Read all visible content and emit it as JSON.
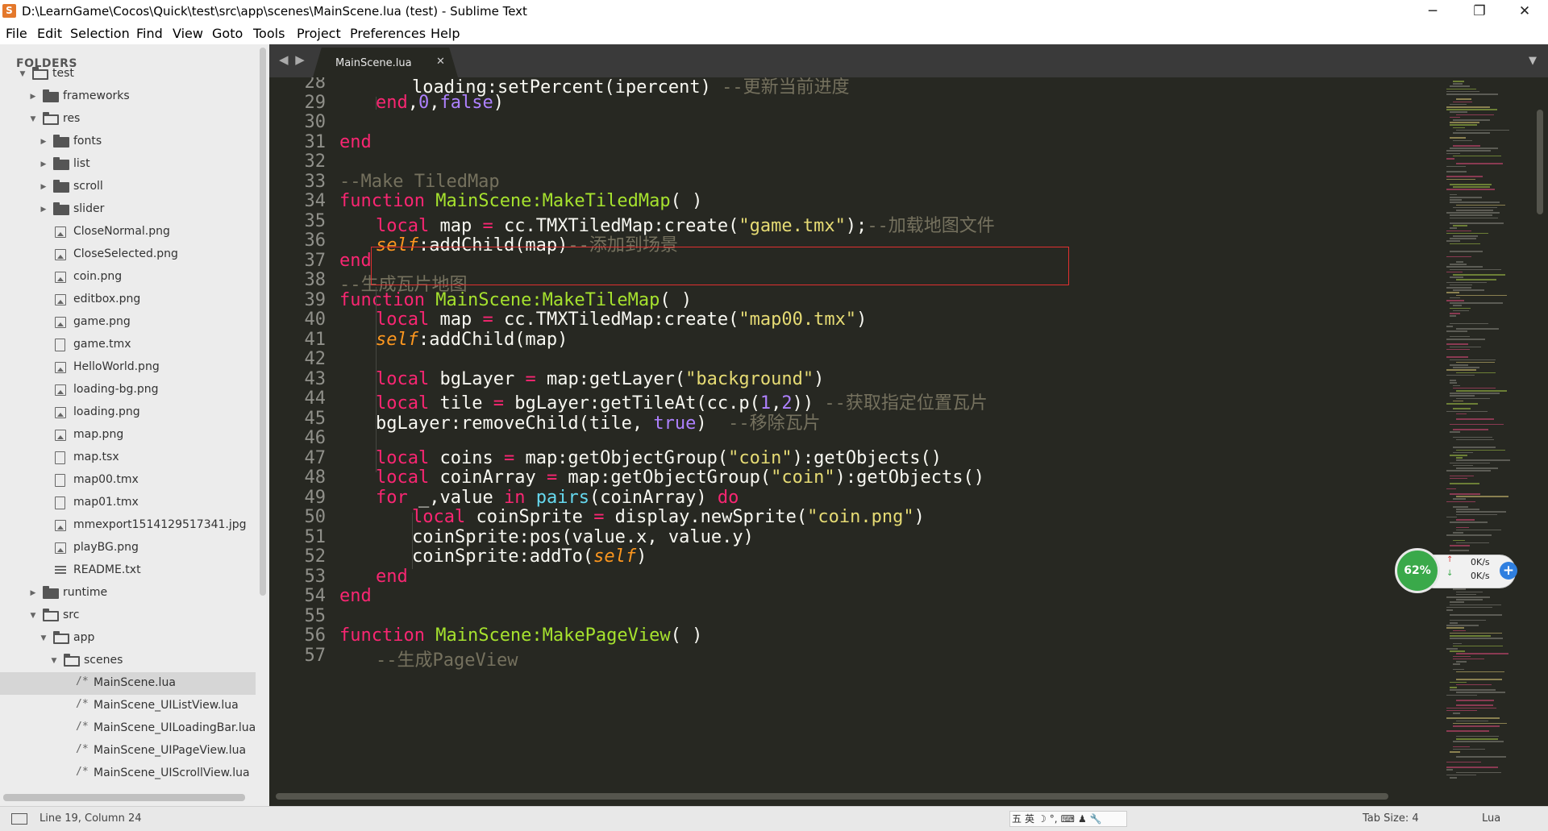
{
  "window": {
    "title": "D:\\LearnGame\\Cocos\\Quick\\test\\src\\app\\scenes\\MainScene.lua (test) - Sublime Text",
    "app_icon_glyph": "S",
    "minimize_glyph": "─",
    "maximize_glyph": "❐",
    "close_glyph": "✕"
  },
  "menu": [
    "File",
    "Edit",
    "Selection",
    "Find",
    "View",
    "Goto",
    "Tools",
    "Project",
    "Preferences",
    "Help"
  ],
  "sidebar": {
    "header": "FOLDERS",
    "tree": [
      {
        "label": "test",
        "type": "folder",
        "expanded": true
      },
      {
        "label": "frameworks",
        "type": "folder",
        "expanded": false
      },
      {
        "label": "res",
        "type": "folder",
        "expanded": true
      },
      {
        "label": "fonts",
        "type": "folder",
        "expanded": false
      },
      {
        "label": "list",
        "type": "folder",
        "expanded": false
      },
      {
        "label": "scroll",
        "type": "folder",
        "expanded": false
      },
      {
        "label": "slider",
        "type": "folder",
        "expanded": false
      },
      {
        "label": "CloseNormal.png",
        "type": "image"
      },
      {
        "label": "CloseSelected.png",
        "type": "image"
      },
      {
        "label": "coin.png",
        "type": "image"
      },
      {
        "label": "editbox.png",
        "type": "image"
      },
      {
        "label": "game.png",
        "type": "image"
      },
      {
        "label": "game.tmx",
        "type": "doc"
      },
      {
        "label": "HelloWorld.png",
        "type": "image"
      },
      {
        "label": "loading-bg.png",
        "type": "image"
      },
      {
        "label": "loading.png",
        "type": "image"
      },
      {
        "label": "map.png",
        "type": "image"
      },
      {
        "label": "map.tsx",
        "type": "doc"
      },
      {
        "label": "map00.tmx",
        "type": "doc"
      },
      {
        "label": "map01.tmx",
        "type": "doc"
      },
      {
        "label": "mmexport1514129517341.jpg",
        "type": "image"
      },
      {
        "label": "playBG.png",
        "type": "image"
      },
      {
        "label": "README.txt",
        "type": "text"
      },
      {
        "label": "runtime",
        "type": "folder",
        "expanded": false
      },
      {
        "label": "src",
        "type": "folder",
        "expanded": true
      },
      {
        "label": "app",
        "type": "folder",
        "expanded": true
      },
      {
        "label": "scenes",
        "type": "folder",
        "expanded": true
      },
      {
        "label": "MainScene.lua",
        "type": "lua",
        "selected": true
      },
      {
        "label": "MainScene_UIListView.lua",
        "type": "lua"
      },
      {
        "label": "MainScene_UILoadingBar.lua",
        "type": "lua"
      },
      {
        "label": "MainScene_UIPageView.lua",
        "type": "lua"
      },
      {
        "label": "MainScene_UIScrollView.lua",
        "type": "lua"
      }
    ]
  },
  "tabs": {
    "nav": "◀ ▶",
    "active": {
      "label": "MainScene.lua",
      "close_glyph": "✕"
    },
    "dropdown_glyph": "▼"
  },
  "editor": {
    "lines": [
      {
        "no": "28",
        "indent": 2,
        "tokens": [
          [
            "",
            "loading:setPercent(ipercent) "
          ],
          [
            "cm",
            "--更新当前进度"
          ]
        ]
      },
      {
        "no": "29",
        "indent": 1,
        "tokens": [
          [
            "kw",
            "end"
          ],
          [
            "",
            ","
          ],
          [
            "num",
            "0"
          ],
          [
            "",
            ","
          ],
          [
            "num",
            "false"
          ],
          [
            "",
            ")"
          ]
        ]
      },
      {
        "no": "30",
        "indent": 0,
        "tokens": []
      },
      {
        "no": "31",
        "indent": 0,
        "tokens": [
          [
            "kw",
            "end"
          ]
        ]
      },
      {
        "no": "32",
        "indent": 0,
        "tokens": []
      },
      {
        "no": "33",
        "indent": 0,
        "tokens": [
          [
            "cm",
            "--Make TiledMap"
          ]
        ]
      },
      {
        "no": "34",
        "indent": 0,
        "tokens": [
          [
            "kw",
            "function "
          ],
          [
            "fn",
            "MainScene:MakeTiledMap"
          ],
          [
            "",
            "( )"
          ]
        ]
      },
      {
        "no": "35",
        "indent": 1,
        "tokens": [
          [
            "kw",
            "local"
          ],
          [
            "",
            " map "
          ],
          [
            "kw",
            "="
          ],
          [
            "",
            " cc.TMXTiledMap:create("
          ],
          [
            "str",
            "\"game.tmx\""
          ],
          [
            "",
            ");"
          ],
          [
            "cm",
            "--加载地图文件"
          ]
        ]
      },
      {
        "no": "36",
        "indent": 1,
        "tokens": [
          [
            "sf",
            "self"
          ],
          [
            "",
            ":addChild(map)"
          ],
          [
            "cm",
            "--添加到场景"
          ]
        ]
      },
      {
        "no": "37",
        "indent": 0,
        "tokens": [
          [
            "kw",
            "end"
          ]
        ]
      },
      {
        "no": "38",
        "indent": 0,
        "tokens": [
          [
            "cm",
            "--生成瓦片地图"
          ]
        ]
      },
      {
        "no": "39",
        "indent": 0,
        "tokens": [
          [
            "kw",
            "function "
          ],
          [
            "fn",
            "MainScene:MakeTileMap"
          ],
          [
            "",
            "( )"
          ]
        ]
      },
      {
        "no": "40",
        "indent": 1,
        "tokens": [
          [
            "kw",
            "local"
          ],
          [
            "",
            " map "
          ],
          [
            "kw",
            "="
          ],
          [
            "",
            " cc.TMXTiledMap:create("
          ],
          [
            "str",
            "\"map00.tmx\""
          ],
          [
            "",
            ")"
          ]
        ]
      },
      {
        "no": "41",
        "indent": 1,
        "tokens": [
          [
            "sf",
            "self"
          ],
          [
            "",
            ":addChild(map)"
          ]
        ]
      },
      {
        "no": "42",
        "indent": 0,
        "tokens": []
      },
      {
        "no": "43",
        "indent": 1,
        "tokens": [
          [
            "kw",
            "local"
          ],
          [
            "",
            " bgLayer "
          ],
          [
            "kw",
            "="
          ],
          [
            "",
            " map:getLayer("
          ],
          [
            "str",
            "\"background\""
          ],
          [
            "",
            ")"
          ]
        ]
      },
      {
        "no": "44",
        "indent": 1,
        "tokens": [
          [
            "kw",
            "local"
          ],
          [
            "",
            " tile "
          ],
          [
            "kw",
            "="
          ],
          [
            "",
            " bgLayer:getTileAt(cc.p("
          ],
          [
            "num",
            "1"
          ],
          [
            "",
            ","
          ],
          [
            "num",
            "2"
          ],
          [
            "",
            ")) "
          ],
          [
            "cm",
            "--获取指定位置瓦片"
          ]
        ]
      },
      {
        "no": "45",
        "indent": 1,
        "tokens": [
          [
            "",
            "bgLayer:removeChild(tile, "
          ],
          [
            "num",
            "true"
          ],
          [
            "",
            ")  "
          ],
          [
            "cm",
            "--移除瓦片"
          ]
        ]
      },
      {
        "no": "46",
        "indent": 0,
        "tokens": []
      },
      {
        "no": "47",
        "indent": 1,
        "tokens": [
          [
            "kw",
            "local"
          ],
          [
            "",
            " coins "
          ],
          [
            "kw",
            "="
          ],
          [
            "",
            " map:getObjectGroup("
          ],
          [
            "str",
            "\"coin\""
          ],
          [
            "",
            "):getObjects()"
          ]
        ]
      },
      {
        "no": "48",
        "indent": 1,
        "tokens": [
          [
            "kw",
            "local"
          ],
          [
            "",
            " coinArray "
          ],
          [
            "kw",
            "="
          ],
          [
            "",
            " map:getObjectGroup("
          ],
          [
            "str",
            "\"coin\""
          ],
          [
            "",
            "):getObjects()"
          ]
        ]
      },
      {
        "no": "49",
        "indent": 1,
        "tokens": [
          [
            "kw",
            "for"
          ],
          [
            "",
            " _,value "
          ],
          [
            "kw",
            "in"
          ],
          [
            "",
            " "
          ],
          [
            "bi",
            "pairs"
          ],
          [
            "",
            "(coinArray) "
          ],
          [
            "kw",
            "do"
          ]
        ]
      },
      {
        "no": "50",
        "indent": 2,
        "tokens": [
          [
            "kw",
            "local"
          ],
          [
            "",
            " coinSprite "
          ],
          [
            "kw",
            "="
          ],
          [
            "",
            " display.newSprite("
          ],
          [
            "str",
            "\"coin.png\""
          ],
          [
            "",
            ")"
          ]
        ]
      },
      {
        "no": "51",
        "indent": 2,
        "tokens": [
          [
            "",
            "coinSprite:pos(value.x, value.y)"
          ]
        ]
      },
      {
        "no": "52",
        "indent": 2,
        "tokens": [
          [
            "",
            "coinSprite:addTo("
          ],
          [
            "sf",
            "self"
          ],
          [
            "",
            ")"
          ]
        ]
      },
      {
        "no": "53",
        "indent": 1,
        "tokens": [
          [
            "kw",
            "end"
          ]
        ]
      },
      {
        "no": "54",
        "indent": 0,
        "tokens": [
          [
            "kw",
            "end"
          ]
        ]
      },
      {
        "no": "55",
        "indent": 0,
        "tokens": []
      },
      {
        "no": "56",
        "indent": 0,
        "tokens": [
          [
            "kw",
            "function "
          ],
          [
            "fn",
            "MainScene:MakePageView"
          ],
          [
            "",
            "( )"
          ]
        ]
      },
      {
        "no": "57",
        "indent": 1,
        "tokens": [
          [
            "cm",
            "--生成PageView"
          ]
        ]
      }
    ]
  },
  "net_widget": {
    "percent": "62%",
    "upload": "0K/s",
    "download": "0K/s",
    "up_arrow": "↑",
    "down_arrow": "↓",
    "plus": "+"
  },
  "statusbar": {
    "position": "Line 19, Column 24",
    "tab_size": "Tab Size: 4",
    "syntax": "Lua",
    "ime_items": [
      "五",
      "英",
      "☽",
      "°,",
      "⌨",
      "♟",
      "🔧"
    ]
  },
  "colors": {
    "editor_bg": "#272822",
    "keyword": "#f92672",
    "function": "#a6e22e",
    "string": "#e6db74",
    "number": "#ae81ff",
    "comment": "#75715e",
    "self": "#fd971f",
    "builtin": "#66d9ef",
    "highlight_box": "#e03030"
  }
}
